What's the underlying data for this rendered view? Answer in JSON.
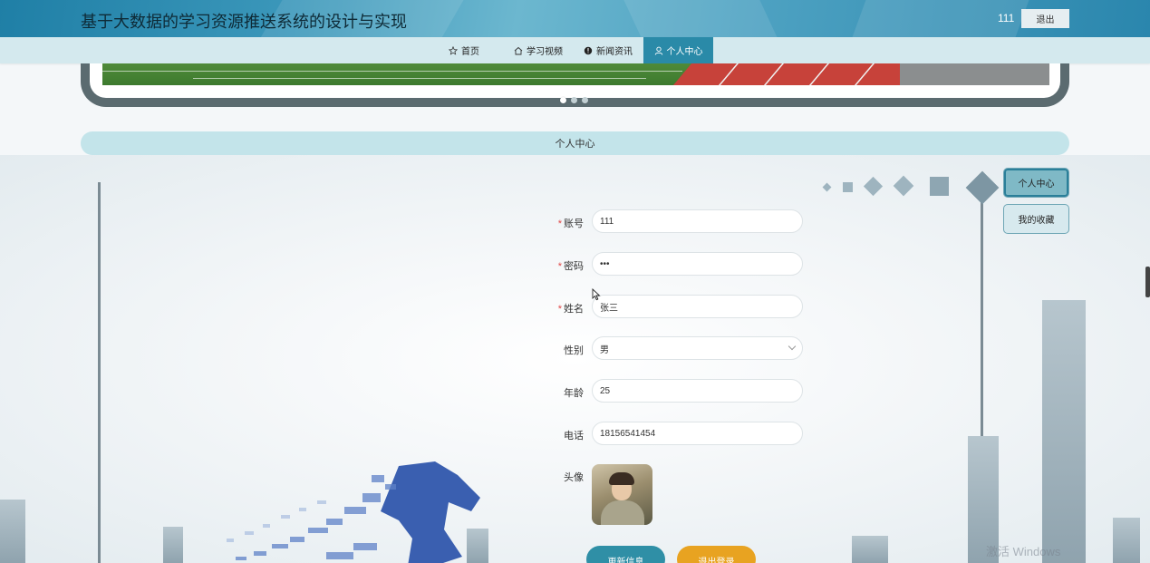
{
  "header": {
    "title": "基于大数据的学习资源推送系统的设计与实现",
    "username": "111",
    "logout_label": "退出"
  },
  "nav": {
    "items": [
      {
        "label": "首页",
        "icon": "star-icon"
      },
      {
        "label": "学习视频",
        "icon": "home-icon"
      },
      {
        "label": "新闻资讯",
        "icon": "info-icon"
      },
      {
        "label": "个人中心",
        "icon": "user-icon",
        "active": true
      }
    ]
  },
  "carousel": {
    "slides": 3,
    "active_index": 0
  },
  "section": {
    "title": "个人中心"
  },
  "side_menu": {
    "items": [
      {
        "label": "个人中心",
        "active": true
      },
      {
        "label": "我的收藏",
        "active": false
      }
    ]
  },
  "form": {
    "fields": [
      {
        "label": "账号",
        "required": true,
        "value": "111"
      },
      {
        "label": "密码",
        "required": true,
        "value": "•••"
      },
      {
        "label": "姓名",
        "required": true,
        "value": "张三"
      },
      {
        "label": "性别",
        "required": false,
        "value": "男",
        "type": "select"
      },
      {
        "label": "年龄",
        "required": false,
        "value": "25"
      },
      {
        "label": "电话",
        "required": false,
        "value": "18156541454"
      }
    ],
    "avatar_label": "头像",
    "update_label": "更新信息",
    "logout_label": "退出登录"
  },
  "watermark": "激活 Windows",
  "colors": {
    "header": "#2a86ad",
    "nav_active": "#2a8aa8",
    "section_bar": "#c3e4ea",
    "update_button": "#2f8fa6",
    "logout_button": "#e8a321",
    "required": "#e04848"
  }
}
